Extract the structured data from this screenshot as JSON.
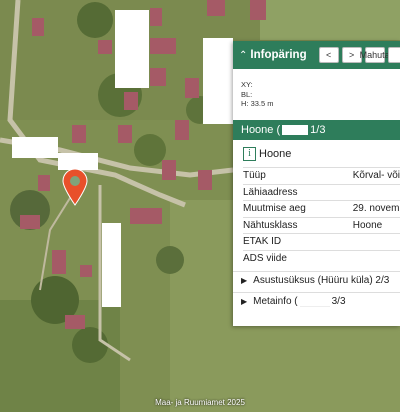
{
  "panel": {
    "title": "Infopäring",
    "prev_label": "<",
    "next_label": ">",
    "fit_label": "Mahuta",
    "more_label": "",
    "coords": {
      "xy": "XY:",
      "bl": "BL:",
      "h": "H: 33.5 m"
    },
    "feature": {
      "name_prefix": "Hoone (",
      "counter": "1/3"
    },
    "type_label": "Hoone",
    "attributes": [
      {
        "key": "Tüüp",
        "value": "Kõrval- või"
      },
      {
        "key": "Lähiaadress",
        "value": ""
      },
      {
        "key": "Muutmise aeg",
        "value": "29. novem"
      },
      {
        "key": "Nähtusklass",
        "value": "Hoone"
      },
      {
        "key": "ETAK ID",
        "value": ""
      },
      {
        "key": "ADS viide",
        "value": ""
      }
    ],
    "sections": [
      {
        "label": "Asustusüksus (Hüüru küla) 2/3"
      },
      {
        "label_prefix": "Metainfo (",
        "label_suffix": "3/3"
      }
    ]
  },
  "map": {
    "credit": "Maa- ja Ruumiamet 2025",
    "marker_color": "#e8502a",
    "panel_green": "#2e7d5b"
  },
  "icons": {
    "collapse": "chevron-up-icon",
    "info": "info-icon",
    "expand": "triangle-right-icon",
    "marker": "map-pin-icon"
  }
}
